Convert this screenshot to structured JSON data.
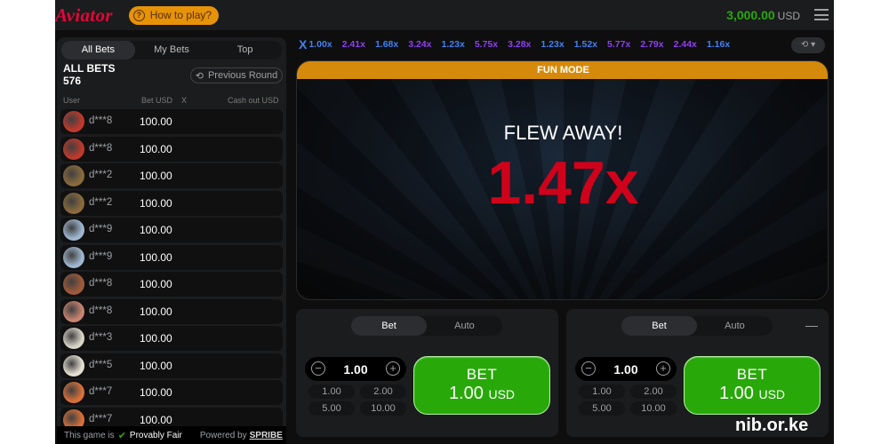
{
  "header": {
    "logo": "Aviator",
    "how_to_play": "How to play?",
    "balance": "3,000.00",
    "currency": "USD"
  },
  "bets_panel": {
    "tabs": [
      "All Bets",
      "My Bets",
      "Top"
    ],
    "title": "ALL BETS",
    "count": "576",
    "previous_round": "Previous Round",
    "columns": {
      "user": "User",
      "bet": "Bet USD",
      "x": "X",
      "cashout": "Cash out USD"
    },
    "rows": [
      {
        "user": "d***8",
        "bet": "100.00",
        "avatar_color": "#c0392b"
      },
      {
        "user": "d***8",
        "bet": "100.00",
        "avatar_color": "#c0392b"
      },
      {
        "user": "d***2",
        "bet": "100.00",
        "avatar_color": "#8a6a3c"
      },
      {
        "user": "d***2",
        "bet": "100.00",
        "avatar_color": "#8a6a3c"
      },
      {
        "user": "d***9",
        "bet": "100.00",
        "avatar_color": "#9fb7cf"
      },
      {
        "user": "d***9",
        "bet": "100.00",
        "avatar_color": "#9fb7cf"
      },
      {
        "user": "d***8",
        "bet": "100.00",
        "avatar_color": "#a05a3a"
      },
      {
        "user": "d***8",
        "bet": "100.00",
        "avatar_color": "#c98470"
      },
      {
        "user": "d***3",
        "bet": "100.00",
        "avatar_color": "#d8d4c8"
      },
      {
        "user": "d***5",
        "bet": "100.00",
        "avatar_color": "#e5e0d2"
      },
      {
        "user": "d***7",
        "bet": "100.00",
        "avatar_color": "#d8703a"
      },
      {
        "user": "d***7",
        "bet": "100.00",
        "avatar_color": "#d8703a"
      }
    ],
    "footer": {
      "prefix": "This game is",
      "provably_fair": "Provably Fair",
      "powered_by": "Powered by",
      "brand": "SPRIBE"
    }
  },
  "multipliers": [
    {
      "v": "1.00x",
      "color": "#3c82f6"
    },
    {
      "v": "2.41x",
      "color": "#913ef8"
    },
    {
      "v": "1.68x",
      "color": "#3c82f6"
    },
    {
      "v": "3.24x",
      "color": "#913ef8"
    },
    {
      "v": "1.23x",
      "color": "#3c82f6"
    },
    {
      "v": "5.75x",
      "color": "#913ef8"
    },
    {
      "v": "3.28x",
      "color": "#913ef8"
    },
    {
      "v": "1.23x",
      "color": "#3c82f6"
    },
    {
      "v": "1.52x",
      "color": "#3c82f6"
    },
    {
      "v": "5.77x",
      "color": "#913ef8"
    },
    {
      "v": "2.79x",
      "color": "#913ef8"
    },
    {
      "v": "2.44x",
      "color": "#913ef8"
    },
    {
      "v": "1.16x",
      "color": "#3c82f6"
    }
  ],
  "stage": {
    "fun_mode": "FUN MODE",
    "status": "FLEW AWAY!",
    "crash_multiplier": "1.47x"
  },
  "bet_panels": [
    {
      "tabs": [
        "Bet",
        "Auto"
      ],
      "amount": "1.00",
      "quick": [
        "1.00",
        "2.00",
        "5.00",
        "10.00"
      ],
      "button_label": "BET",
      "button_amount": "1.00",
      "button_currency": "USD"
    },
    {
      "tabs": [
        "Bet",
        "Auto"
      ],
      "amount": "1.00",
      "quick": [
        "1.00",
        "2.00",
        "5.00",
        "10.00"
      ],
      "button_label": "BET",
      "button_amount": "1.00",
      "button_currency": "USD"
    }
  ],
  "watermark": "nib.or.ke"
}
